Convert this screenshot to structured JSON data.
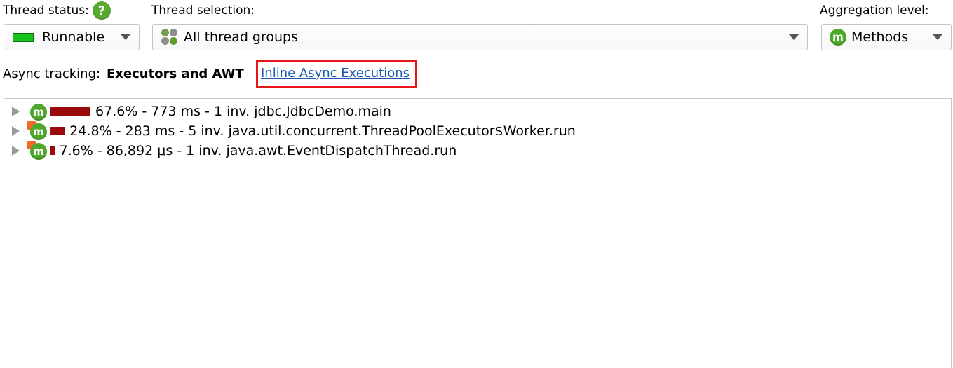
{
  "header": {
    "thread_status_label": "Thread status:",
    "thread_selection_label": "Thread selection:",
    "aggregation_label": "Aggregation level:"
  },
  "thread_status": {
    "value": "Runnable",
    "swatch_color": "#17c41c"
  },
  "thread_selection": {
    "value": "All thread groups"
  },
  "aggregation": {
    "value": "Methods",
    "icon_letter": "m"
  },
  "async": {
    "label": "Async tracking:",
    "value": "Executors and AWT",
    "link": "Inline Async Executions",
    "highlight_color": "#e8161b"
  },
  "tree": {
    "rows": [
      {
        "text": "67.6% - 773 ms - 1 inv. jdbc.JdbcDemo.main",
        "percent": 67.6,
        "async": false
      },
      {
        "text": "24.8% - 283 ms - 5 inv. java.util.concurrent.ThreadPoolExecutor$Worker.run",
        "percent": 24.8,
        "async": true
      },
      {
        "text": "7.6% - 86,892 μs - 1 inv. java.awt.EventDispatchThread.run",
        "percent": 7.6,
        "async": true
      }
    ],
    "bar_color": "#9b0a0a"
  }
}
